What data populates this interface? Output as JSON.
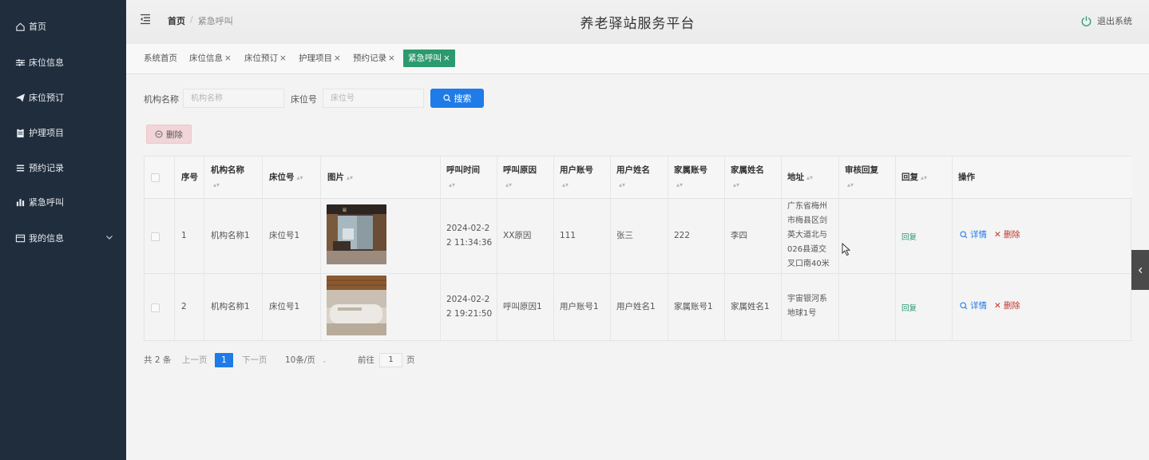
{
  "sidebar": {
    "items": [
      {
        "label": "首页",
        "icon": "home-icon"
      },
      {
        "label": "床位信息",
        "icon": "sliders-icon"
      },
      {
        "label": "床位预订",
        "icon": "paper-plane-icon"
      },
      {
        "label": "护理项目",
        "icon": "clipboard-icon"
      },
      {
        "label": "预约记录",
        "icon": "list-icon"
      },
      {
        "label": "紧急呼叫",
        "icon": "bar-chart-icon"
      },
      {
        "label": "我的信息",
        "icon": "card-icon"
      }
    ]
  },
  "header": {
    "breadcrumb_home": "首页",
    "breadcrumb_sep": "/",
    "breadcrumb_current": "紧急呼叫",
    "title": "养老驿站服务平台",
    "logout_label": "退出系统"
  },
  "tabs": [
    {
      "label": "系统首页",
      "closable": false
    },
    {
      "label": "床位信息",
      "closable": true
    },
    {
      "label": "床位预订",
      "closable": true
    },
    {
      "label": "护理项目",
      "closable": true
    },
    {
      "label": "预约记录",
      "closable": true
    },
    {
      "label": "紧急呼叫",
      "closable": true,
      "active": true
    }
  ],
  "search": {
    "org_label": "机构名称",
    "org_placeholder": "机构名称",
    "bed_label": "床位号",
    "bed_placeholder": "床位号",
    "search_button": "搜索"
  },
  "toolbar": {
    "delete_label": "删除"
  },
  "table": {
    "headers": {
      "index": "序号",
      "org": "机构名称",
      "bed": "床位号",
      "image": "图片",
      "call_time": "呼叫时间",
      "call_reason": "呼叫原因",
      "user_account": "用户账号",
      "user_name": "用户姓名",
      "family_account": "家属账号",
      "family_name": "家属姓名",
      "address": "地址",
      "audit_reply": "审核回复",
      "reply": "回复",
      "actions": "操作"
    },
    "rows": [
      {
        "index": "1",
        "org": "机构名称1",
        "bed": "床位号1",
        "call_time_l1": "2024-02-2",
        "call_time_l2": "2 11:34:36",
        "call_reason": "XX原因",
        "user_account": "111",
        "user_name": "张三",
        "family_account": "222",
        "family_name": "李四",
        "address_lines": [
          "广东省梅州",
          "市梅县区剑",
          "英大道北与",
          "026县道交",
          "叉口南40米"
        ],
        "audit_reply": "",
        "reply_link": "回复",
        "detail_label": "详情",
        "delete_label": "删除"
      },
      {
        "index": "2",
        "org": "机构名称1",
        "bed": "床位号1",
        "call_time_l1": "2024-02-2",
        "call_time_l2": "2 19:21:50",
        "call_reason": "呼叫原因1",
        "user_account": "用户账号1",
        "user_name": "用户姓名1",
        "family_account": "家属账号1",
        "family_name": "家属姓名1",
        "address_lines": [
          "宇宙银河系",
          "地球1号"
        ],
        "audit_reply": "",
        "reply_link": "回复",
        "detail_label": "详情",
        "delete_label": "删除"
      }
    ]
  },
  "pagination": {
    "total": "共 2 条",
    "prev": "上一页",
    "current": "1",
    "next": "下一页",
    "page_size": "10条/页",
    "goto_label": "前往",
    "goto_value": "1",
    "page_suffix": "页"
  },
  "colors": {
    "sidebar_bg": "#1f2d3d",
    "accent_green": "#2b9a6e",
    "primary_blue": "#1e7be8",
    "danger_red": "#c0392b"
  }
}
